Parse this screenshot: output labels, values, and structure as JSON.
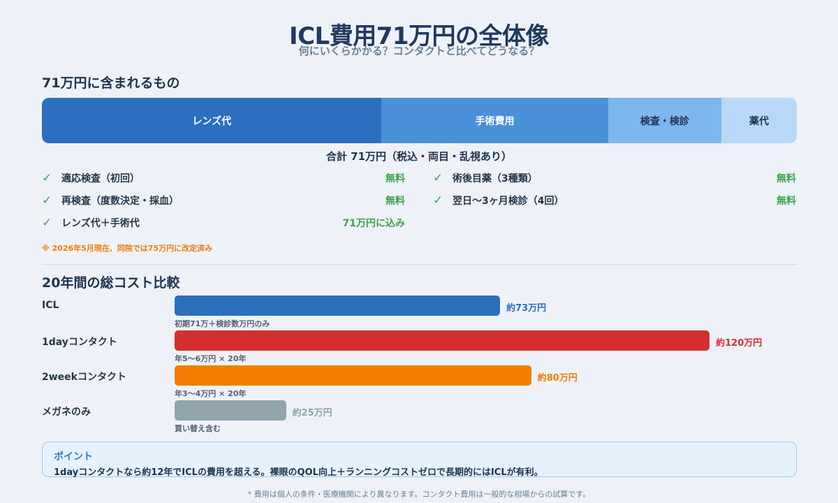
{
  "header": {
    "title": "ICL費用71万円の全体像",
    "subtitle": "何にいくらかかる？コンタクトと比べてどうなる？"
  },
  "breakdown": {
    "section_title": "71万円に含まれるもの",
    "segments": [
      {
        "label": "レンズ代",
        "share": 0.45,
        "color": "#2c6fbe",
        "text_color": "#ffffff"
      },
      {
        "label": "手術費用",
        "share": 0.3,
        "color": "#4a90d9",
        "text_color": "#ffffff"
      },
      {
        "label": "検査・検診",
        "share": 0.15,
        "color": "#7db6ec",
        "text_color": "#1e3350"
      },
      {
        "label": "薬代",
        "share": 0.1,
        "color": "#b9d8f7",
        "text_color": "#1e3350"
      }
    ],
    "total": "合計 71万円（税込・両目・乱視あり）",
    "included": [
      {
        "check": "✓",
        "label": "適応検査（初回）",
        "value": "無料"
      },
      {
        "check": "✓",
        "label": "術後目薬（3種類）",
        "value": "無料"
      },
      {
        "check": "✓",
        "label": "再検査（度数決定・採血）",
        "value": "無料"
      },
      {
        "check": "✓",
        "label": "翌日〜3ヶ月検診（4回）",
        "value": "無料"
      },
      {
        "check": "✓",
        "label": "レンズ代＋手術代",
        "value": "71万円に込み"
      }
    ],
    "note": "※ 2026年5月現在、同院では75万円に改定済み"
  },
  "chart_data": {
    "type": "bar",
    "title": "20年間の総コスト比較",
    "unit": "万円",
    "xlim": [
      0,
      130
    ],
    "categories": [
      "ICL",
      "1dayコンタクト",
      "2weekコンタクト",
      "メガネのみ"
    ],
    "values": [
      73,
      120,
      80,
      25
    ],
    "value_labels": [
      "約73万円",
      "約120万円",
      "約80万円",
      "約25万円"
    ],
    "sub_labels": [
      "初期71万＋検診数万円のみ",
      "年5〜6万円 × 20年",
      "年3〜4万円 × 20年",
      "買い替え含む"
    ],
    "colors": [
      "#2c6fbe",
      "#d32f2f",
      "#f57c00",
      "#90a4ae"
    ]
  },
  "point": {
    "title": "ポイント",
    "text": "1dayコンタクトなら約12年でICLの費用を超える。裸眼のQOL向上＋ランニングコストゼロで長期的にはICLが有利。"
  },
  "footer": "* 費用は個人の条件・医療機関により異なります。コンタクト費用は一般的な相場からの試算です。"
}
